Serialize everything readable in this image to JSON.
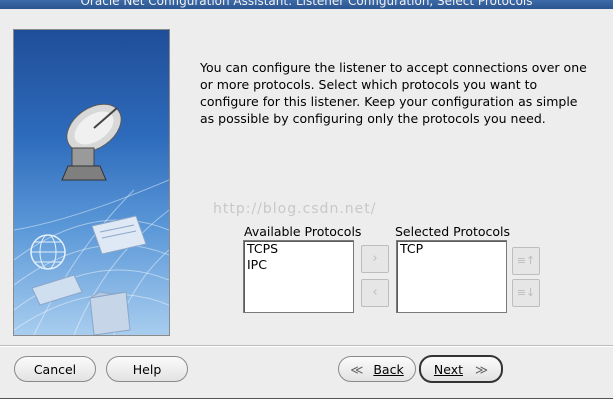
{
  "window": {
    "title": "Oracle Net Configuration Assistant: Listener Configuration, Select Protocols"
  },
  "description": "You can configure the listener to accept connections over one or more protocols. Select which protocols you want to configure for this listener. Keep your configuration as simple as possible by configuring only the protocols you need.",
  "watermark": "http://blog.csdn.net/",
  "available": {
    "label": "Available Protocols",
    "items": [
      "TCPS",
      "IPC"
    ]
  },
  "selected": {
    "label": "Selected Protocols",
    "items": [
      "TCP"
    ]
  },
  "arrows": {
    "add": "›",
    "remove": "‹",
    "move_up": "≡↑",
    "move_down": "≡↓"
  },
  "buttons": {
    "cancel": "Cancel",
    "help": "Help",
    "back_arrow": "≪",
    "back": "Back",
    "next": "Next",
    "next_arrow": "≫"
  },
  "colors": {
    "panel": "#2e6bbc",
    "background": "#ededed"
  },
  "icons": [
    "satellite-dish-icon",
    "globe-icon",
    "document-icon",
    "folder-icon"
  ]
}
